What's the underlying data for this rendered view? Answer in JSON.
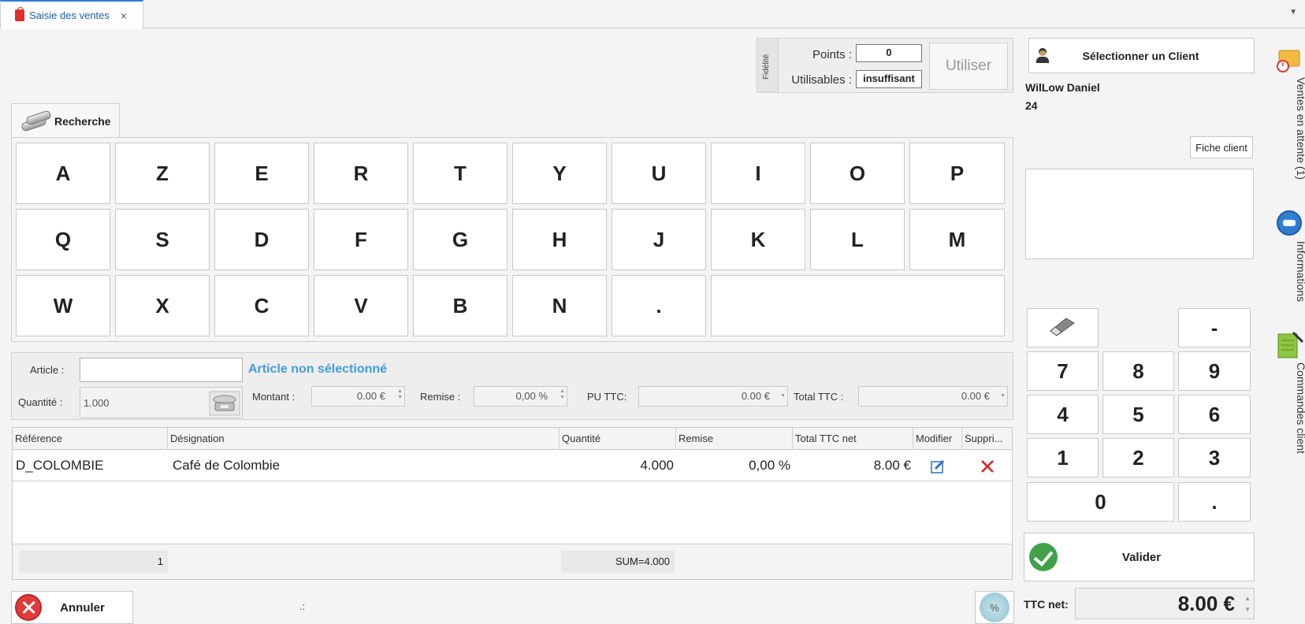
{
  "tab": {
    "title": "Saisie des ventes",
    "close": "×"
  },
  "fidelity": {
    "side_label": "Fidélité",
    "points_label": "Points :",
    "points_value": "0",
    "usable_label": "Utilisables :",
    "usable_value": "insuffisant",
    "use_button": "Utiliser"
  },
  "client": {
    "select_button": "Sélectionner un Client",
    "name": "WilLow Daniel",
    "number": "24",
    "file_button": "Fiche client"
  },
  "side_panel": {
    "pending": "Ventes en attente (1)",
    "info": "Informations",
    "orders": "Commandes client"
  },
  "search": {
    "tab_label": "Recherche"
  },
  "keyboard": {
    "row1": [
      "A",
      "Z",
      "E",
      "R",
      "T",
      "Y",
      "U",
      "I",
      "O",
      "P"
    ],
    "row2": [
      "Q",
      "S",
      "D",
      "F",
      "G",
      "H",
      "J",
      "K",
      "L",
      "M"
    ],
    "row3": [
      "W",
      "X",
      "C",
      "V",
      "B",
      "N",
      "."
    ]
  },
  "article": {
    "article_label": "Article :",
    "article_value": "",
    "status": "Article non sélectionné",
    "quantity_label": "Quantité :",
    "quantity_value": "1.000",
    "amount_label": "Montant :",
    "amount_value": "0.00 €",
    "discount_label": "Remise :",
    "discount_value": "0,00 %",
    "unit_price_label": "PU TTC:",
    "unit_price_value": "0.00 €",
    "total_label": "Total TTC :",
    "total_value": "0.00 €"
  },
  "grid": {
    "columns": [
      "Référence",
      "Désignation",
      "Quantité",
      "Remise",
      "Total TTC net",
      "Modifier",
      "Suppri..."
    ],
    "rows": [
      {
        "reference": "D_COLOMBIE",
        "designation": "Café de Colombie",
        "quantity": "4.000",
        "discount": "0,00 %",
        "total": "8.00 €"
      }
    ],
    "footer_count": "1",
    "footer_sum": "SUM=4.000"
  },
  "bottom": {
    "cancel_button": "Annuler",
    "status": ".:",
    "discount_icon": "%"
  },
  "numpad": {
    "minus": "-",
    "keys": [
      "7",
      "8",
      "9",
      "4",
      "5",
      "6",
      "1",
      "2",
      "3"
    ],
    "zero": "0",
    "dot": ".",
    "validate": "Valider"
  },
  "total": {
    "label": "TTC net:",
    "value": "8.00 €"
  },
  "colors": {
    "accent": "#2b7cd3",
    "link": "#3f9fd8",
    "delete": "#d32020",
    "validate": "#3fa24a",
    "cancel": "#e23a3a"
  },
  "icons": [
    "shopping-bag-icon",
    "client-icon",
    "binoculars-icon",
    "scale-icon",
    "edit-icon",
    "delete-icon",
    "cancel-icon",
    "check-icon",
    "percent-icon",
    "eraser-icon",
    "pending-sales-icon",
    "info-icon",
    "orders-icon"
  ]
}
